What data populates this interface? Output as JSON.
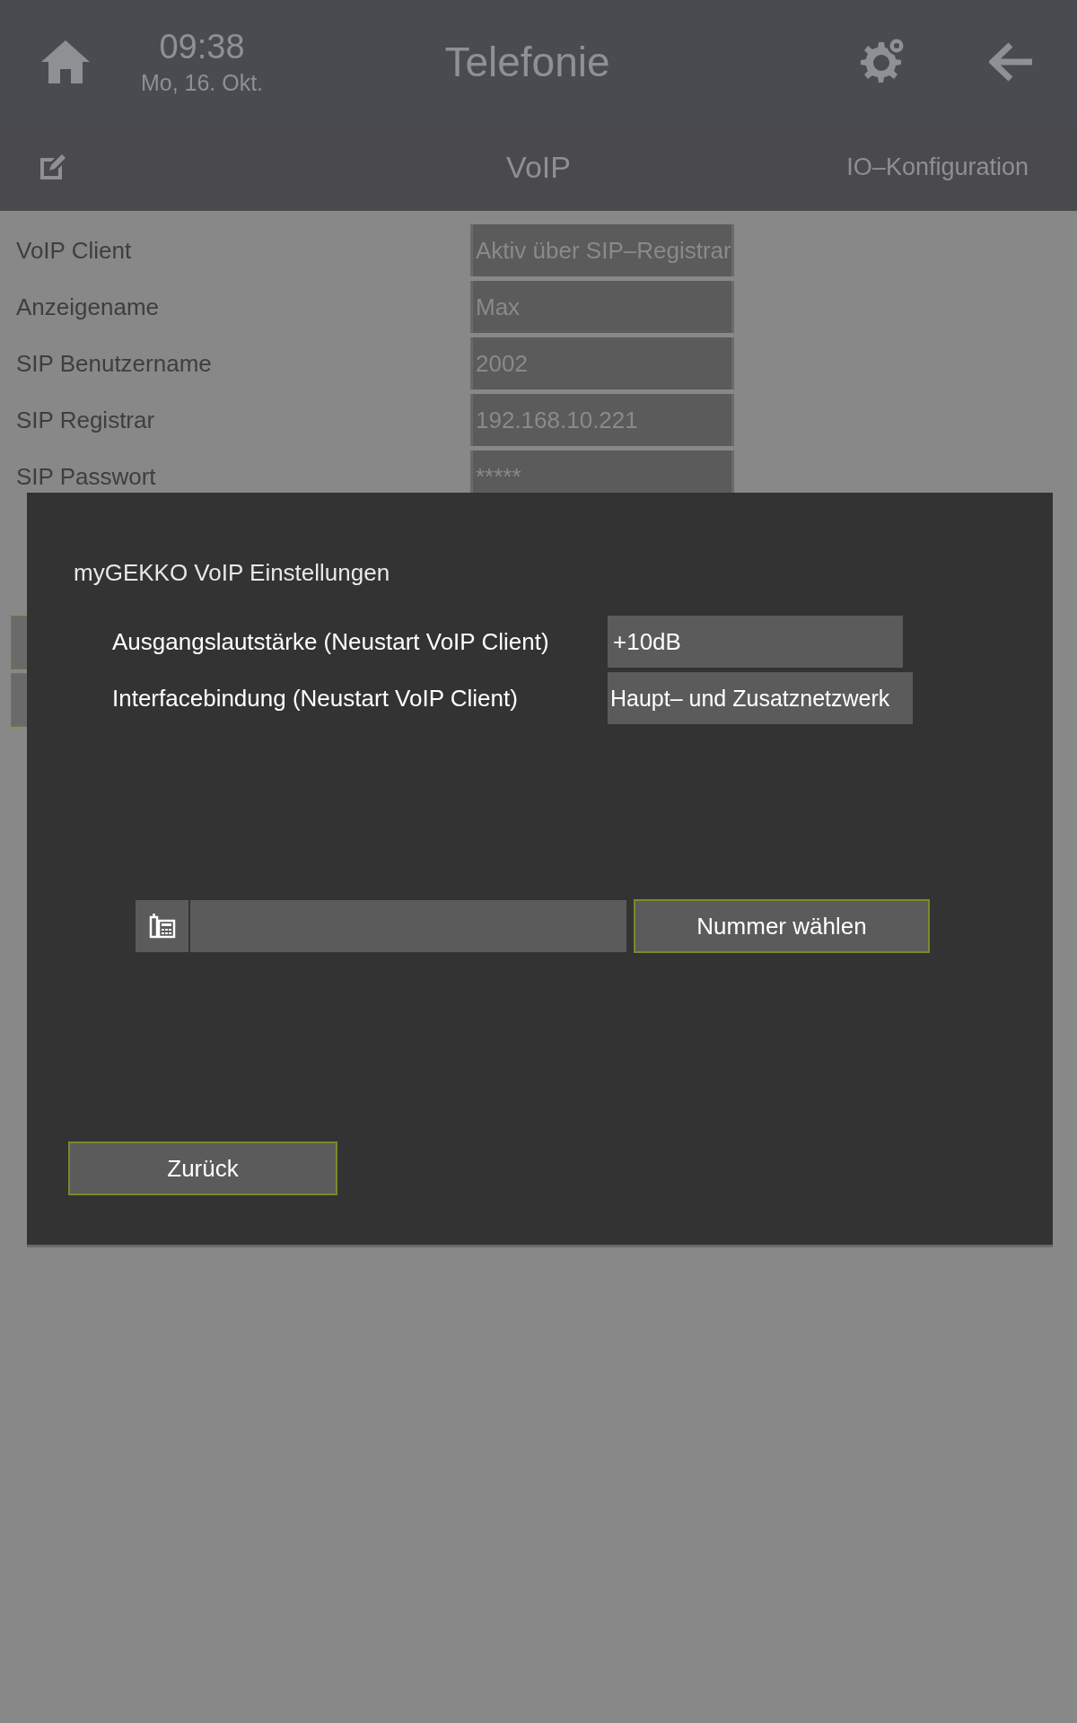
{
  "header": {
    "time": "09:38",
    "date": "Mo, 16. Okt.",
    "title": "Telefonie"
  },
  "subbar": {
    "title": "VoIP",
    "link": "IO–Konfiguration"
  },
  "settings": [
    {
      "label": "VoIP Client",
      "value": "Aktiv über SIP–Registrar"
    },
    {
      "label": "Anzeigename",
      "value": "Max"
    },
    {
      "label": "SIP Benutzername",
      "value": "2002"
    },
    {
      "label": "SIP Registrar",
      "value": "192.168.10.221"
    },
    {
      "label": "SIP Passwort",
      "value": "*****"
    }
  ],
  "side_buttons": [
    {
      "kind": "button"
    },
    {
      "kind": "button"
    }
  ],
  "dialog": {
    "title": "myGEKKO VoIP Einstellungen",
    "rows": [
      {
        "label": "Ausgangslautstärke (Neustart VoIP Client)",
        "value": "+10dB"
      },
      {
        "label": "Interfacebindung (Neustart VoIP Client)",
        "value": "Haupt– und Zusatznetzwerk"
      }
    ],
    "dial_button": "Nummer wählen",
    "back_button": "Zurück"
  }
}
